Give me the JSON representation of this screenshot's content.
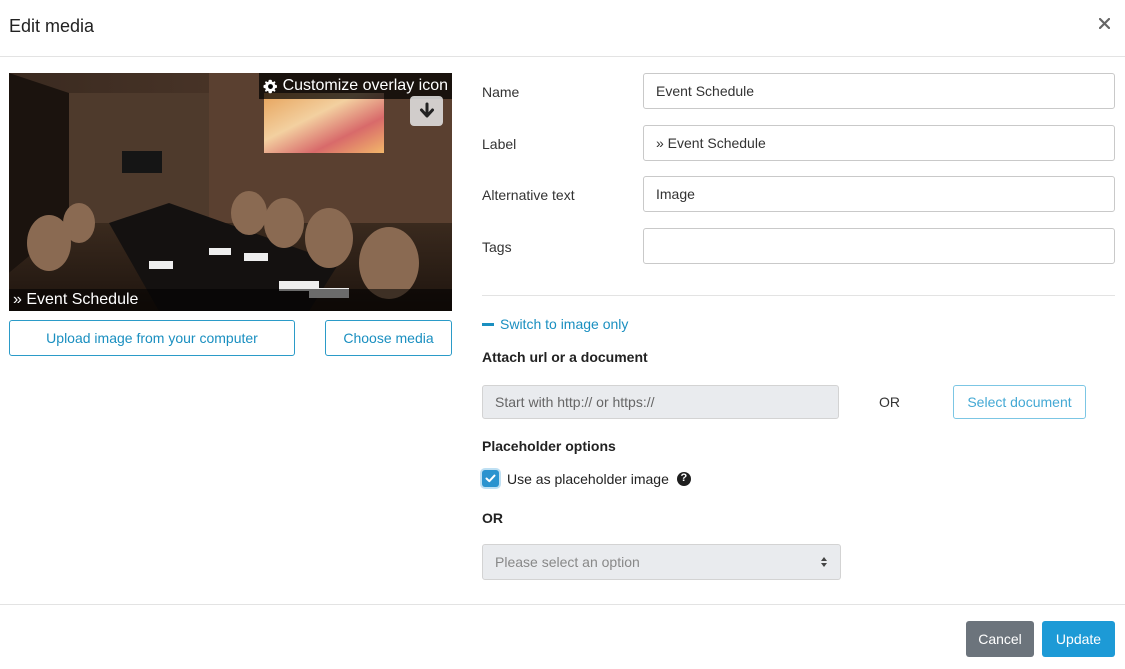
{
  "dialog": {
    "title": "Edit media"
  },
  "image_panel": {
    "overlay_label": "Customize overlay icon",
    "caption": "» Event Schedule",
    "upload_label": "Upload image from your computer",
    "choose_label": "Choose media"
  },
  "form": {
    "name_label": "Name",
    "name_value": "Event Schedule",
    "label_label": "Label",
    "label_value": "» Event Schedule",
    "alt_label": "Alternative text",
    "alt_value": "Image",
    "tags_label": "Tags",
    "tags_value": ""
  },
  "link_section": {
    "switch_label": "Switch to image only",
    "attach_title": "Attach url or a document",
    "url_placeholder": "Start with http:// or https://",
    "or_text": "OR",
    "select_document_label": "Select document"
  },
  "placeholder_section": {
    "title": "Placeholder options",
    "checkbox_label": "Use as placeholder image",
    "checkbox_checked": true,
    "or_text": "OR",
    "select_placeholder": "Please select an option"
  },
  "footer": {
    "cancel_label": "Cancel",
    "update_label": "Update"
  },
  "colors": {
    "accent": "#1d9ad6",
    "cancel": "#6c747c",
    "link": "#1a8fc0"
  }
}
